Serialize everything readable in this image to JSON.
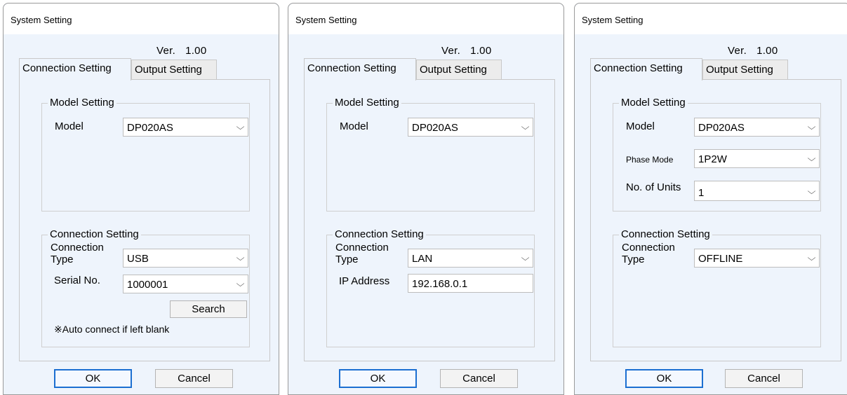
{
  "dialogs": [
    {
      "title": "System Setting",
      "ver_label": "Ver.",
      "ver_value": "1.00",
      "tabs": [
        "Connection Setting",
        "Output Setting"
      ],
      "model_group": {
        "legend": "Model Setting",
        "model_label": "Model",
        "model_value": "DP020AS"
      },
      "conn_group": {
        "legend": "Connection Setting",
        "type_label_1": "Connection",
        "type_label_2": "Type",
        "type_value": "USB",
        "serial_label": "Serial No.",
        "serial_value": "1000001",
        "search_button": "Search",
        "note": "※Auto connect if left blank"
      },
      "ok_button": "OK",
      "cancel_button": "Cancel"
    },
    {
      "title": "System Setting",
      "ver_label": "Ver.",
      "ver_value": "1.00",
      "tabs": [
        "Connection Setting",
        "Output Setting"
      ],
      "model_group": {
        "legend": "Model Setting",
        "model_label": "Model",
        "model_value": "DP020AS"
      },
      "conn_group": {
        "legend": "Connection Setting",
        "type_label_1": "Connection",
        "type_label_2": "Type",
        "type_value": "LAN",
        "ip_label": "IP Address",
        "ip_value": "192.168.0.1"
      },
      "ok_button": "OK",
      "cancel_button": "Cancel"
    },
    {
      "title": "System Setting",
      "ver_label": "Ver.",
      "ver_value": "1.00",
      "tabs": [
        "Connection Setting",
        "Output Setting"
      ],
      "model_group": {
        "legend": "Model Setting",
        "model_label": "Model",
        "model_value": "DP020AS",
        "phase_label": "Phase Mode",
        "phase_value": "1P2W",
        "units_label": "No. of Units",
        "units_value": "1"
      },
      "conn_group": {
        "legend": "Connection Setting",
        "type_label_1": "Connection",
        "type_label_2": "Type",
        "type_value": "OFFLINE"
      },
      "ok_button": "OK",
      "cancel_button": "Cancel"
    }
  ],
  "icons": {
    "dropdown": "chevron-down-icon"
  },
  "colors": {
    "dialog_bg": "#eef4fc",
    "ok_border": "#1c6fd1"
  }
}
